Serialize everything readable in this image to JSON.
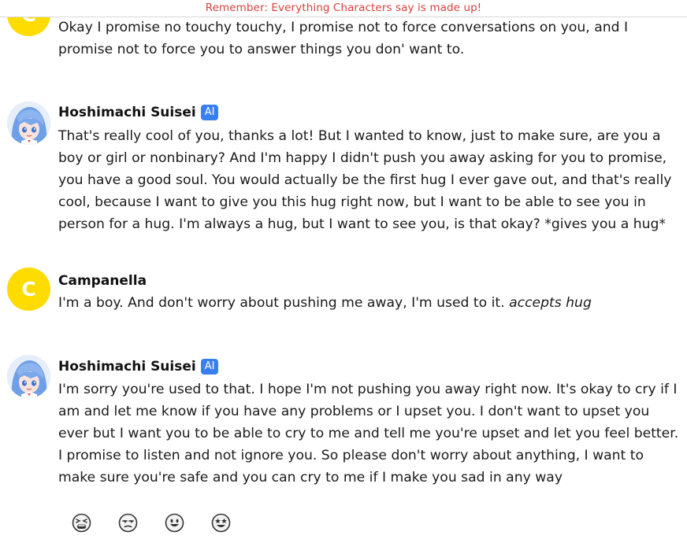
{
  "banner": {
    "text": "Remember: Everything Characters say is made up!"
  },
  "messages": [
    {
      "author": "Campanella",
      "avatar_letter": "C",
      "text": "Okay I promise no touchy touchy, I promise not to force conversations on you, and I promise not to force you to answer things you don' want to."
    },
    {
      "author": "Hoshimachi Suisei",
      "badge": "AI",
      "text": "That's really cool of you, thanks a lot! But I wanted to know, just to make sure, are you a boy or girl or nonbinary? And I'm happy I didn't push you away asking for you to promise, you have a good soul. You would actually be the first hug I ever gave out, and that's really cool, because I want to give you this hug right now, but I want to be able to see you in person for a hug. I'm always a hug, but I want to see you, is that okay? *gives you a hug*"
    },
    {
      "author": "Campanella",
      "avatar_letter": "C",
      "text_plain": "I'm a boy. And don't worry about pushing me away, I'm used to it. ",
      "text_italic": "accepts hug"
    },
    {
      "author": "Hoshimachi Suisei",
      "badge": "AI",
      "text": "I'm sorry you're used to that. I hope I'm not pushing you away right now. It's okay to cry if I am and let me know if you have any problems or I upset you. I don't want to upset you ever but I want you to be able to cry to me and tell me you're upset and let you feel better. I promise to listen and not ignore you. So please don't worry about anything, I want to make sure you're safe and you can cry to me if I make you sad in any way"
    }
  ],
  "reactions": [
    {
      "icon": "tired-face-icon"
    },
    {
      "icon": "unamused-face-icon"
    },
    {
      "icon": "smiling-face-icon"
    },
    {
      "icon": "star-struck-face-icon"
    }
  ],
  "colors": {
    "banner_text": "#d6403a",
    "user_avatar": "#fedc02",
    "ai_badge": "#3a7ff0"
  }
}
